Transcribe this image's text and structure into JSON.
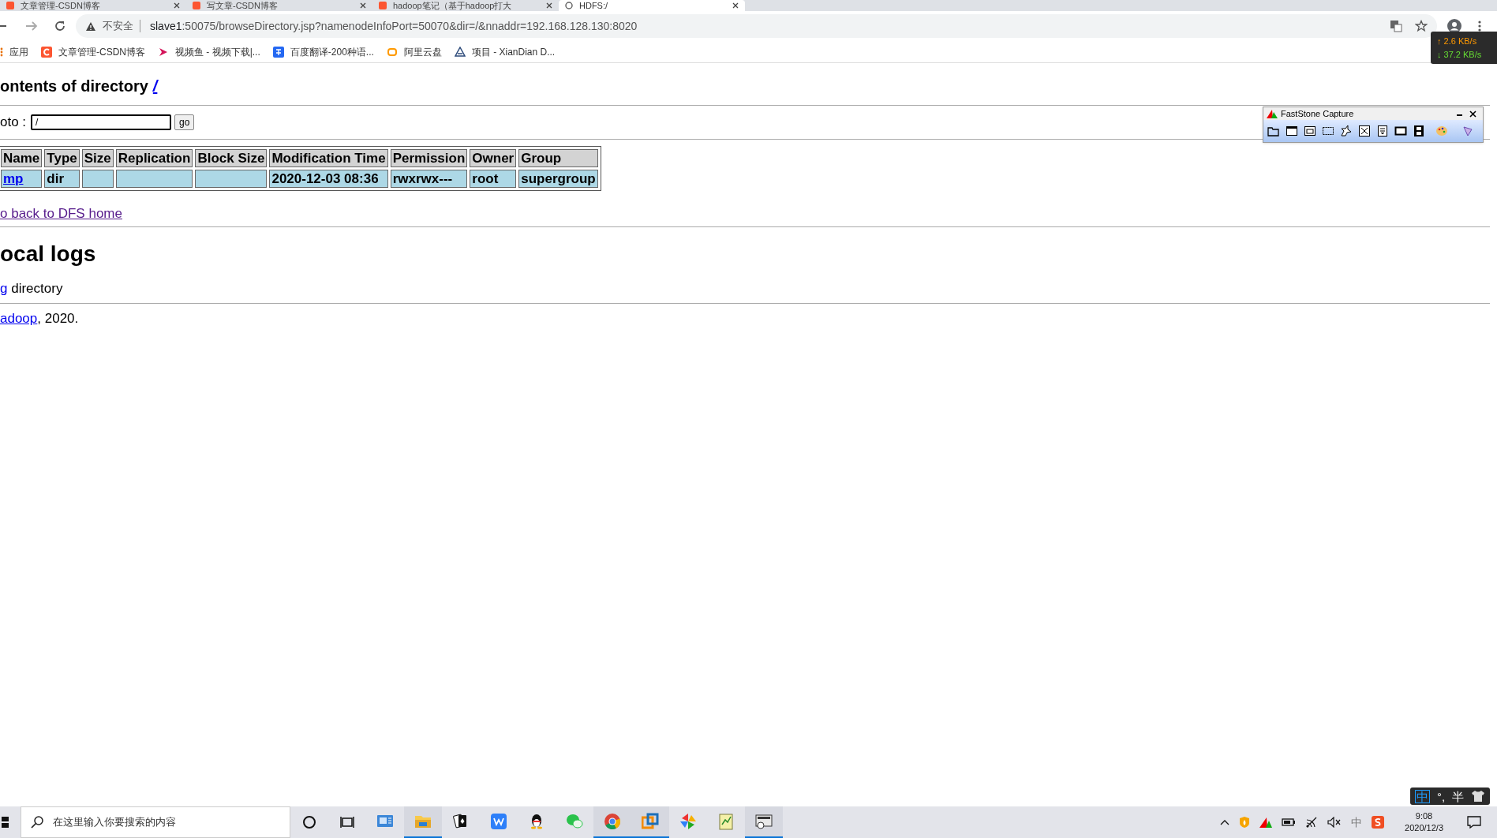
{
  "browser": {
    "tabs": [
      {
        "title": "文章管理-CSDN博客",
        "selected": false
      },
      {
        "title": "写文章-CSDN博客",
        "selected": false
      },
      {
        "title": "hadoop笔记（基于hadoop打大",
        "selected": false
      },
      {
        "title": "HDFS:/",
        "selected": true
      }
    ],
    "address": {
      "security": "不安全",
      "host": "slave1",
      "path": ":50075/browseDirectory.jsp?namenodeInfoPort=50070&dir=/&nnaddr=192.168.128.130:8020"
    },
    "bookmarks": [
      {
        "kind": "apps",
        "label": "应用"
      },
      {
        "kind": "csdn",
        "label": "文章管理-CSDN博客"
      },
      {
        "kind": "video",
        "label": "视频鱼 - 视频下载|..."
      },
      {
        "kind": "translate",
        "label": "百度翻译-200种语..."
      },
      {
        "kind": "cloud",
        "label": "阿里云盘"
      },
      {
        "kind": "project",
        "label": "项目 - XianDian D..."
      }
    ]
  },
  "net_speed": {
    "up": "↑ 2.6 KB/s",
    "down": "↓ 37.2 KB/s"
  },
  "page": {
    "heading": "ontents of directory",
    "heading_link": "/",
    "goto_label": "oto :",
    "goto_value": "/",
    "go_button": "go",
    "table": {
      "columns": [
        "Name",
        "Type",
        "Size",
        "Replication",
        "Block Size",
        "Modification Time",
        "Permission",
        "Owner",
        "Group"
      ],
      "rows": [
        [
          "mp",
          "dir",
          "",
          "",
          "",
          "2020-12-03 08:36",
          "rwxrwx---",
          "root",
          "supergroup"
        ]
      ]
    },
    "back_link": "o back to DFS home",
    "logs_heading": "ocal logs",
    "log_link": "g",
    "log_text": " directory",
    "footer_link": "adoop",
    "footer_text": ", 2020."
  },
  "faststone": {
    "title": "FastStone Capture"
  },
  "taskbar": {
    "search_placeholder": "在这里输入你要搜索的内容",
    "apps": [
      {
        "kind": "manager",
        "running": false
      },
      {
        "kind": "explorer",
        "running": true
      },
      {
        "kind": "cards",
        "running": false
      },
      {
        "kind": "wps",
        "running": false
      },
      {
        "kind": "qq",
        "running": false
      },
      {
        "kind": "wechat",
        "running": false
      },
      {
        "kind": "chrome",
        "running": true
      },
      {
        "kind": "vmware",
        "running": true
      },
      {
        "kind": "pinwheel",
        "running": false
      },
      {
        "kind": "notepad",
        "running": false
      },
      {
        "kind": "remote",
        "running": true
      }
    ],
    "tray_ime": "中",
    "time": "9:08",
    "date": "2020/12/3"
  },
  "ime_bar": {
    "mode": "中",
    "punct": "°,",
    "width": "半"
  }
}
